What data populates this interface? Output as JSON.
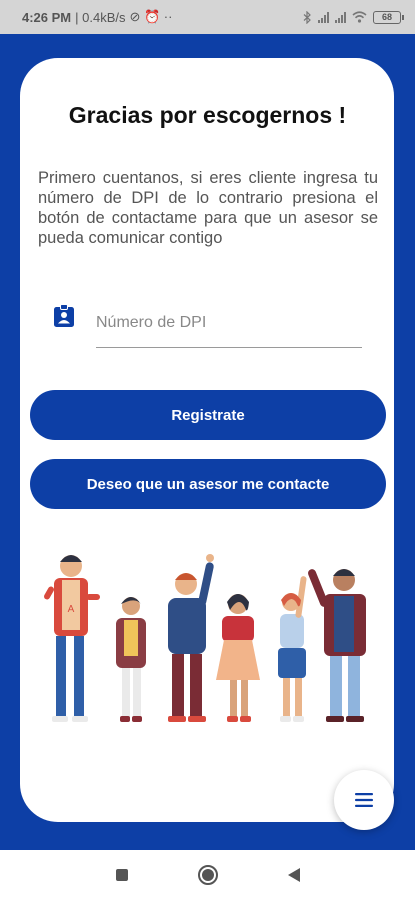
{
  "status_bar": {
    "time": "4:26 PM",
    "network": "| 0.4kB/s",
    "extra_icons": "⊘ ⏰ ··",
    "battery": "68"
  },
  "main": {
    "title": "Gracias por escogernos !",
    "intro": "Primero cuentanos, si eres cliente ingresa tu número de DPI de lo contrario presiona el botón de contactame para que un asesor se pueda comunicar contigo",
    "dpi_input": {
      "placeholder": "Número de DPI",
      "value": ""
    },
    "register_button": "Registrate",
    "contact_button": "Deseo que un asesor me contacte"
  },
  "fab": {
    "icon": "menu-icon"
  },
  "nav_bar": {
    "icons": [
      "recent-apps-icon",
      "home-icon",
      "back-icon"
    ]
  },
  "colors": {
    "primary": "#0d3fa6",
    "card": "#ffffff",
    "status_bar": "#d5d5d5"
  }
}
